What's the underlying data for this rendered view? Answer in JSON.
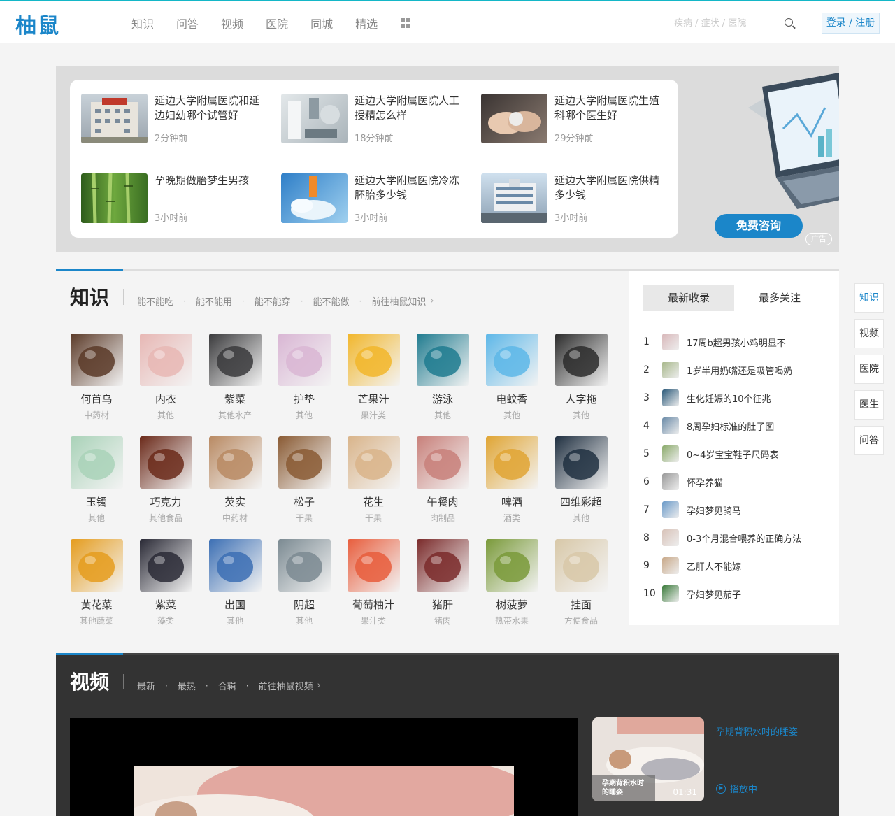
{
  "header": {
    "logo": "柚鼠",
    "nav": [
      "知识",
      "问答",
      "视频",
      "医院",
      "同城",
      "精选"
    ],
    "search_placeholder": "疾病 / 症状 / 医院",
    "login": "登录 / 注册"
  },
  "banner": {
    "items": [
      {
        "title": "延边大学附属医院和延边妇幼哪个试管好",
        "time": "2分钟前",
        "color": "#9aa4ad"
      },
      {
        "title": "延边大学附属医院人工授精怎么样",
        "time": "18分钟前",
        "color": "#b9c3c9"
      },
      {
        "title": "延边大学附属医院生殖科哪个医生好",
        "time": "29分钟前",
        "color": "#6e6560"
      },
      {
        "title": "孕晚期做胎梦生男孩",
        "time": "3小时前",
        "color": "#4f8a2e"
      },
      {
        "title": "延边大学附属医院冷冻胚胎多少钱",
        "time": "3小时前",
        "color": "#5aa4d8"
      },
      {
        "title": "延边大学附属医院供精多少钱",
        "time": "3小时前",
        "color": "#8ea2b5"
      }
    ],
    "free_btn": "免费咨询",
    "ad_label": "广告"
  },
  "knowledge": {
    "title": "知识",
    "links": [
      "能不能吃",
      "能不能用",
      "能不能穿",
      "能不能做",
      "前往柚鼠知识"
    ],
    "items": [
      {
        "name": "何首乌",
        "cat": "中药材",
        "color": "#5b3a28"
      },
      {
        "name": "内衣",
        "cat": "其他",
        "color": "#e7b7b4"
      },
      {
        "name": "紫菜",
        "cat": "其他水产",
        "color": "#3a3a3c"
      },
      {
        "name": "护垫",
        "cat": "其他",
        "color": "#d9b6d4"
      },
      {
        "name": "芒果汁",
        "cat": "果汁类",
        "color": "#f2b62a"
      },
      {
        "name": "游泳",
        "cat": "其他",
        "color": "#1f7b8f"
      },
      {
        "name": "电蚊香",
        "cat": "其他",
        "color": "#5db7e8"
      },
      {
        "name": "人字拖",
        "cat": "其他",
        "color": "#2b2b2b"
      },
      {
        "name": "玉镯",
        "cat": "其他",
        "color": "#a9d2b8"
      },
      {
        "name": "巧克力",
        "cat": "其他食品",
        "color": "#6b2a1a"
      },
      {
        "name": "芡实",
        "cat": "中药材",
        "color": "#b98a63"
      },
      {
        "name": "松子",
        "cat": "干果",
        "color": "#8a5b34"
      },
      {
        "name": "花生",
        "cat": "干果",
        "color": "#d9b48a"
      },
      {
        "name": "午餐肉",
        "cat": "肉制品",
        "color": "#c8807a"
      },
      {
        "name": "啤酒",
        "cat": "酒类",
        "color": "#e0a534"
      },
      {
        "name": "四维彩超",
        "cat": "其他",
        "color": "#203041"
      },
      {
        "name": "黄花菜",
        "cat": "其他蔬菜",
        "color": "#e59c1d"
      },
      {
        "name": "紫菜",
        "cat": "藻类",
        "color": "#2a2a36"
      },
      {
        "name": "出国",
        "cat": "其他",
        "color": "#3c6fb4"
      },
      {
        "name": "阴超",
        "cat": "其他",
        "color": "#7b8a92"
      },
      {
        "name": "葡萄柚汁",
        "cat": "果汁类",
        "color": "#e85d3c"
      },
      {
        "name": "猪肝",
        "cat": "猪肉",
        "color": "#7a2a2a"
      },
      {
        "name": "树菠萝",
        "cat": "热带水果",
        "color": "#7a9a3a"
      },
      {
        "name": "挂面",
        "cat": "方便食品",
        "color": "#d8c8a8"
      }
    ]
  },
  "ranking": {
    "tabs": [
      "最新收录",
      "最多关注"
    ],
    "items": [
      {
        "n": "1",
        "t": "17周b超男孩小鸡明显不",
        "color": "#d8b7b9"
      },
      {
        "n": "2",
        "t": "1岁半用奶嘴还是吸管喝奶",
        "color": "#a7b78a"
      },
      {
        "n": "3",
        "t": "生化妊娠的10个征兆",
        "color": "#2c5a7a"
      },
      {
        "n": "4",
        "t": "8周孕妇标准的肚子图",
        "color": "#6b8ba8"
      },
      {
        "n": "5",
        "t": "0~4岁宝宝鞋子尺码表",
        "color": "#8aaa6a"
      },
      {
        "n": "6",
        "t": "怀孕养猫",
        "color": "#999999"
      },
      {
        "n": "7",
        "t": "孕妇梦见骑马",
        "color": "#6a9ac8"
      },
      {
        "n": "8",
        "t": "0-3个月混合喂养的正确方法",
        "color": "#d8c2b8"
      },
      {
        "n": "9",
        "t": "乙肝人不能嫁",
        "color": "#c8a888"
      },
      {
        "n": "10",
        "t": "孕妇梦见茄子",
        "color": "#3a7a3a"
      }
    ]
  },
  "sidenav": [
    "知识",
    "视频",
    "医院",
    "医生",
    "问答"
  ],
  "video": {
    "title": "视频",
    "links": [
      "最新",
      "最热",
      "合辑",
      "前往柚鼠视频"
    ],
    "side_title": "孕期背积水时的睡姿",
    "thumb_caption": "孕期背积水时的睡姿",
    "duration": "01:31",
    "playing": "播放中"
  }
}
